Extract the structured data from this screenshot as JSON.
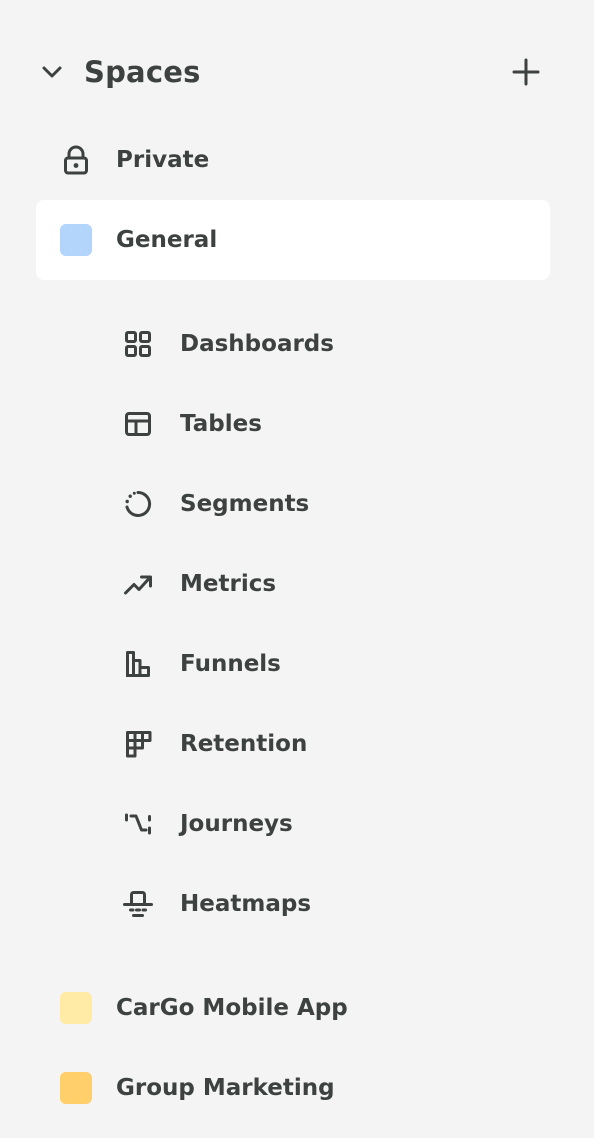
{
  "header": {
    "title": "Spaces",
    "collapse_icon": "chevron-down-icon",
    "add_icon": "plus-icon"
  },
  "spaces": [
    {
      "label": "Private",
      "icon": "lock-icon"
    },
    {
      "label": "General",
      "color": "#b3d4fb",
      "active": true
    },
    {
      "label": "CarGo Mobile App",
      "color": "#ffeaa6"
    },
    {
      "label": "Group Marketing",
      "color": "#ffcf6b"
    }
  ],
  "general_items": [
    {
      "label": "Dashboards",
      "icon": "dashboards-icon"
    },
    {
      "label": "Tables",
      "icon": "tables-icon"
    },
    {
      "label": "Segments",
      "icon": "segments-icon"
    },
    {
      "label": "Metrics",
      "icon": "metrics-icon"
    },
    {
      "label": "Funnels",
      "icon": "funnels-icon"
    },
    {
      "label": "Retention",
      "icon": "retention-icon"
    },
    {
      "label": "Journeys",
      "icon": "journeys-icon"
    },
    {
      "label": "Heatmaps",
      "icon": "heatmaps-icon"
    }
  ],
  "colors": {
    "text": "#3d4241",
    "background": "#f3f4f3",
    "active_row": "#ffffff"
  }
}
